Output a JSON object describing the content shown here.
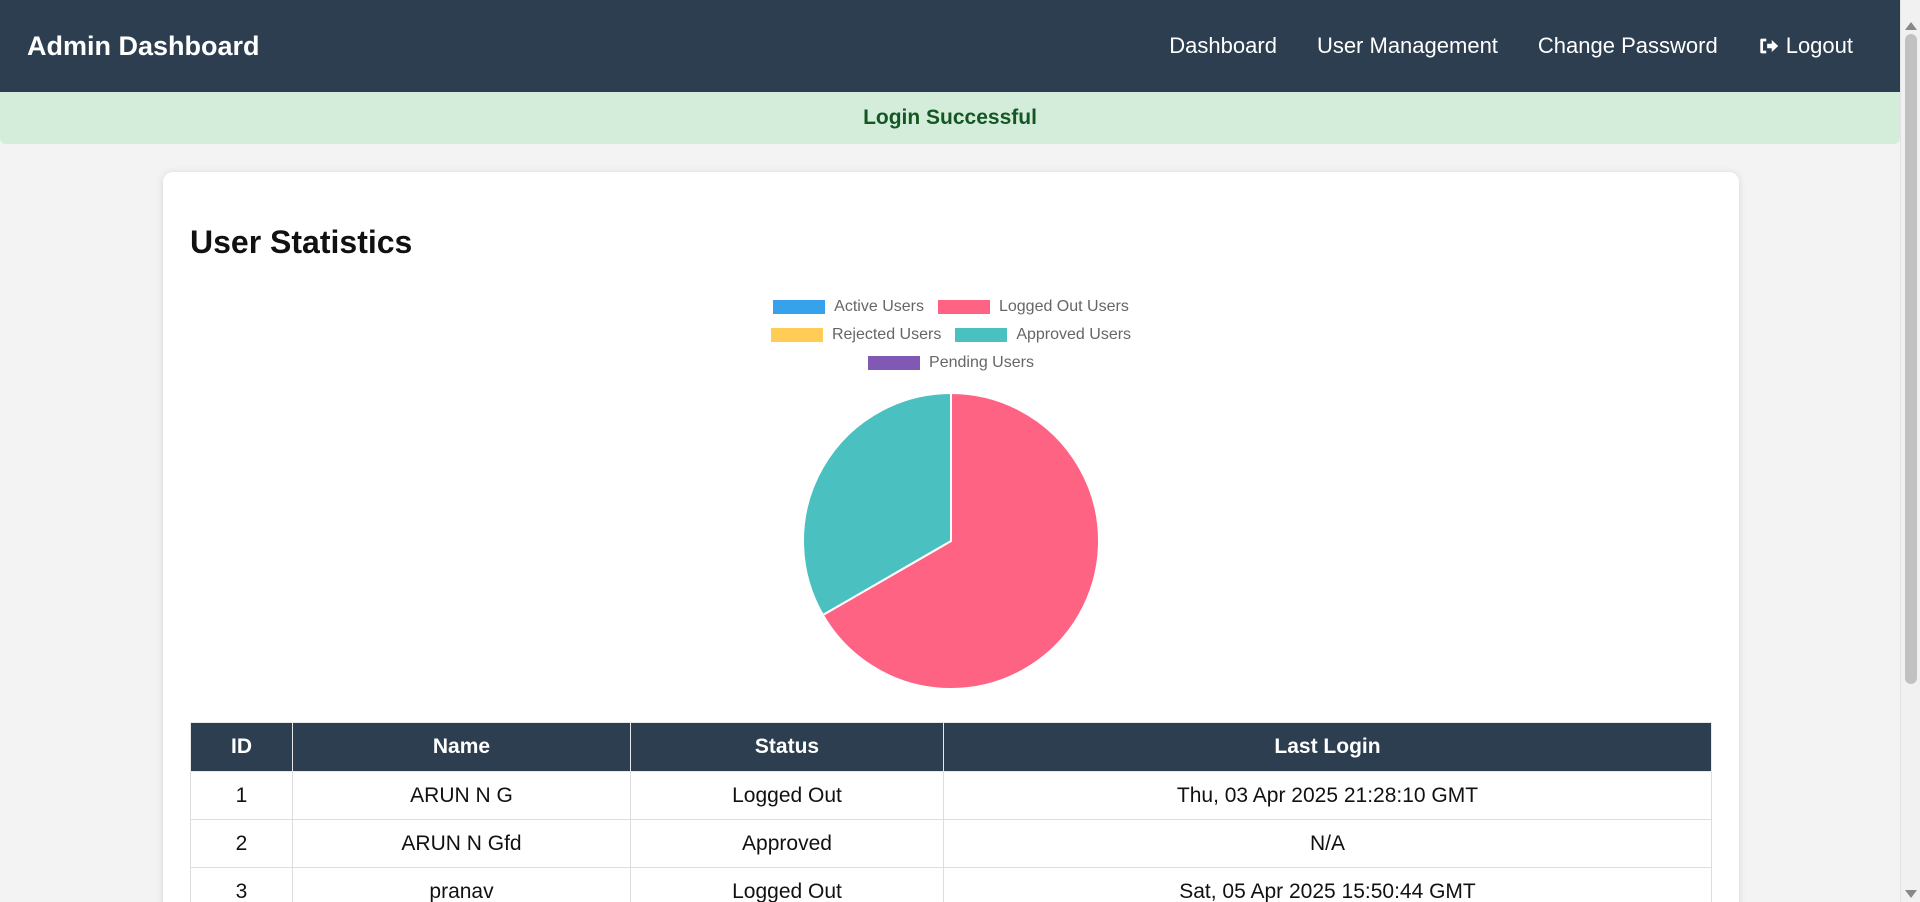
{
  "navbar": {
    "brand": "Admin Dashboard",
    "links": {
      "dashboard": "Dashboard",
      "user_management": "User Management",
      "change_password": "Change Password",
      "logout": "Logout"
    },
    "logout_icon": "sign-out-icon",
    "background": "#2c3e50"
  },
  "alert": {
    "message": "Login Successful",
    "background": "#d4edda",
    "text_color": "#155724"
  },
  "card": {
    "title": "User Statistics"
  },
  "chart_data": {
    "type": "pie",
    "title": "",
    "categories": [
      "Active Users",
      "Logged Out Users",
      "Rejected Users",
      "Approved Users",
      "Pending Users"
    ],
    "values": [
      0,
      2,
      0,
      1,
      0
    ],
    "colors": [
      "#36a2eb",
      "#ff6384",
      "#ffcd56",
      "#4bc0c0",
      "#8059b5"
    ],
    "legend": "top",
    "legend_entries": [
      {
        "label": "Active Users",
        "color": "#36a2eb"
      },
      {
        "label": "Logged Out Users",
        "color": "#ff6384"
      },
      {
        "label": "Rejected Users",
        "color": "#ffcd56"
      },
      {
        "label": "Approved Users",
        "color": "#4bc0c0"
      },
      {
        "label": "Pending Users",
        "color": "#8059b5"
      }
    ]
  },
  "table": {
    "headers": {
      "id": "ID",
      "name": "Name",
      "status": "Status",
      "last_login": "Last Login"
    },
    "rows": [
      {
        "id": "1",
        "name": "ARUN N G",
        "status": "Logged Out",
        "last_login": "Thu, 03 Apr 2025 21:28:10 GMT"
      },
      {
        "id": "2",
        "name": "ARUN N Gfd",
        "status": "Approved",
        "last_login": "N/A"
      },
      {
        "id": "3",
        "name": "pranav",
        "status": "Logged Out",
        "last_login": "Sat, 05 Apr 2025 15:50:44 GMT"
      }
    ]
  }
}
